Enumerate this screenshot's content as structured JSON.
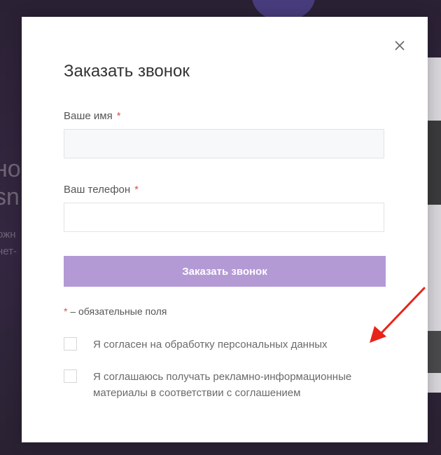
{
  "background": {
    "text_line_1": "но",
    "text_line_2": "sn",
    "text_line_3": "ожн",
    "text_line_4": "нет-"
  },
  "modal": {
    "title": "Заказать звонок",
    "close_icon": "close-icon",
    "fields": {
      "name": {
        "label": "Ваше имя",
        "required_mark": "*",
        "value": "",
        "placeholder": ""
      },
      "phone": {
        "label": "Ваш телефон",
        "required_mark": "*",
        "value": "",
        "placeholder": ""
      }
    },
    "submit_label": "Заказать звонок",
    "required_note": {
      "star": "*",
      "text": " – обязательные поля"
    },
    "consents": [
      {
        "label": "Я согласен на обработку персональных данных",
        "checked": false
      },
      {
        "label": "Я соглашаюсь получать рекламно-информационные материалы в соответствии с соглашением",
        "checked": false
      }
    ]
  },
  "colors": {
    "accent": "#b49ad5",
    "required": "#d9534f",
    "annotation_arrow": "#e8231a"
  }
}
